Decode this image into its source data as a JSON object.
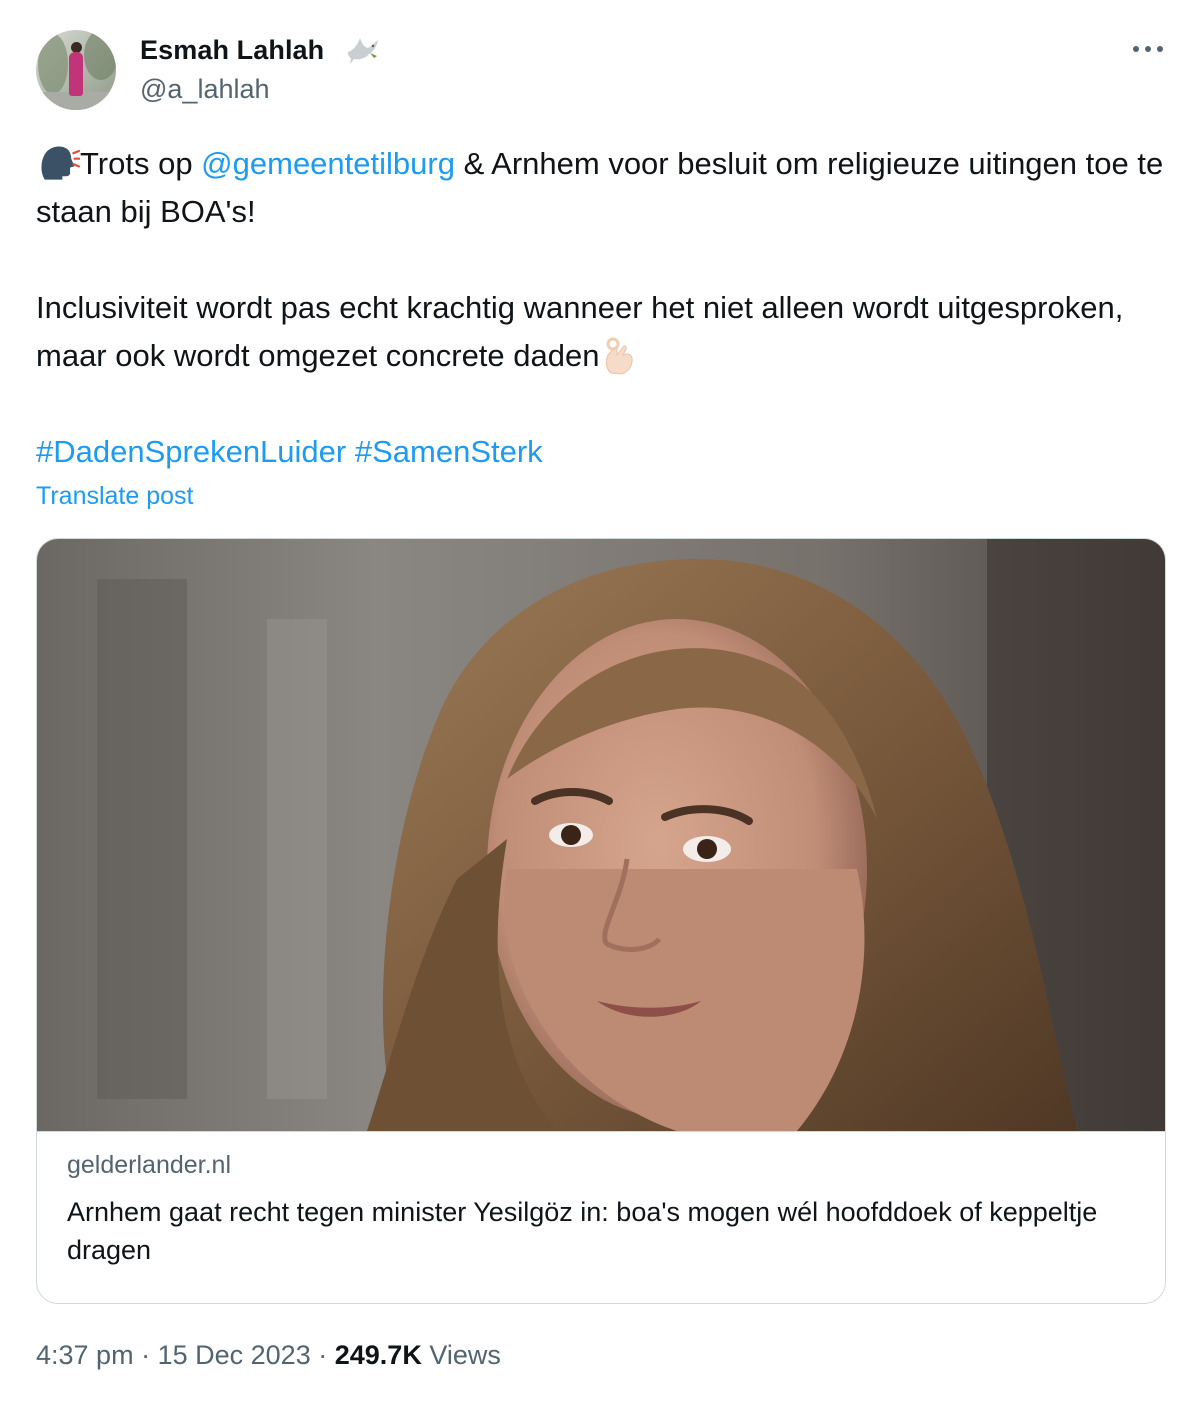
{
  "author": {
    "name": "Esmah Lahlah",
    "handle": "@a_lahlah",
    "name_icon": "dove-icon"
  },
  "post": {
    "line1_emoji": "speaking-head-icon",
    "line1_before": "Trots op ",
    "mention": "@gemeentetilburg",
    "line1_after": " & Arnhem voor besluit om religieuze uitingen toe te staan bij BOA's!",
    "paragraph2": "Inclusiviteit wordt pas echt krachtig wanneer het niet alleen wordt uitgesproken, maar ook wordt omgezet concrete daden",
    "paragraph2_emoji": "ok-hand-icon",
    "hashtag1": "#DadenSprekenLuider",
    "hashtag2": "#SamenSterk",
    "translate_label": "Translate post"
  },
  "card": {
    "domain": "gelderlander.nl",
    "title": "Arnhem gaat recht tegen minister Yesilgöz in: boa's mogen wél hoofddoek of keppeltje dragen"
  },
  "meta": {
    "time": "4:37 pm",
    "separator": "·",
    "date": "15 Dec 2023",
    "views_count": "249.7K",
    "views_label": "Views"
  },
  "colors": {
    "link": "#1d9bf0",
    "secondary_text": "#536471",
    "border": "#cfd9de"
  }
}
